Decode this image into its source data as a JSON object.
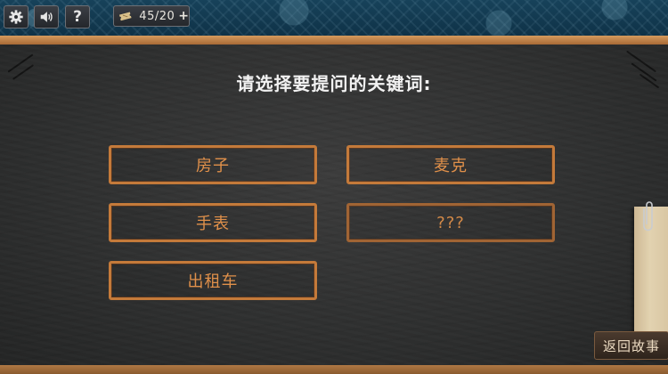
{
  "toolbar": {
    "settings_icon": "gear-icon",
    "sound_icon": "speaker-icon",
    "help_label": "?",
    "ticket_icon": "ticket-icon",
    "ticket_count": "45/20",
    "ticket_plus": "+"
  },
  "board": {
    "question": "请选择要提问的关键词:",
    "keywords": [
      {
        "label": "房子"
      },
      {
        "label": "麦克"
      },
      {
        "label": "手表"
      },
      {
        "label": "???"
      },
      {
        "label": "出租车"
      }
    ]
  },
  "footer": {
    "back_label": "返回故事"
  },
  "colors": {
    "chalkboard": "#2f3030",
    "keyword_border": "#c47a3a",
    "keyword_text": "#e0904a",
    "frame_wood": "#c88a52"
  }
}
